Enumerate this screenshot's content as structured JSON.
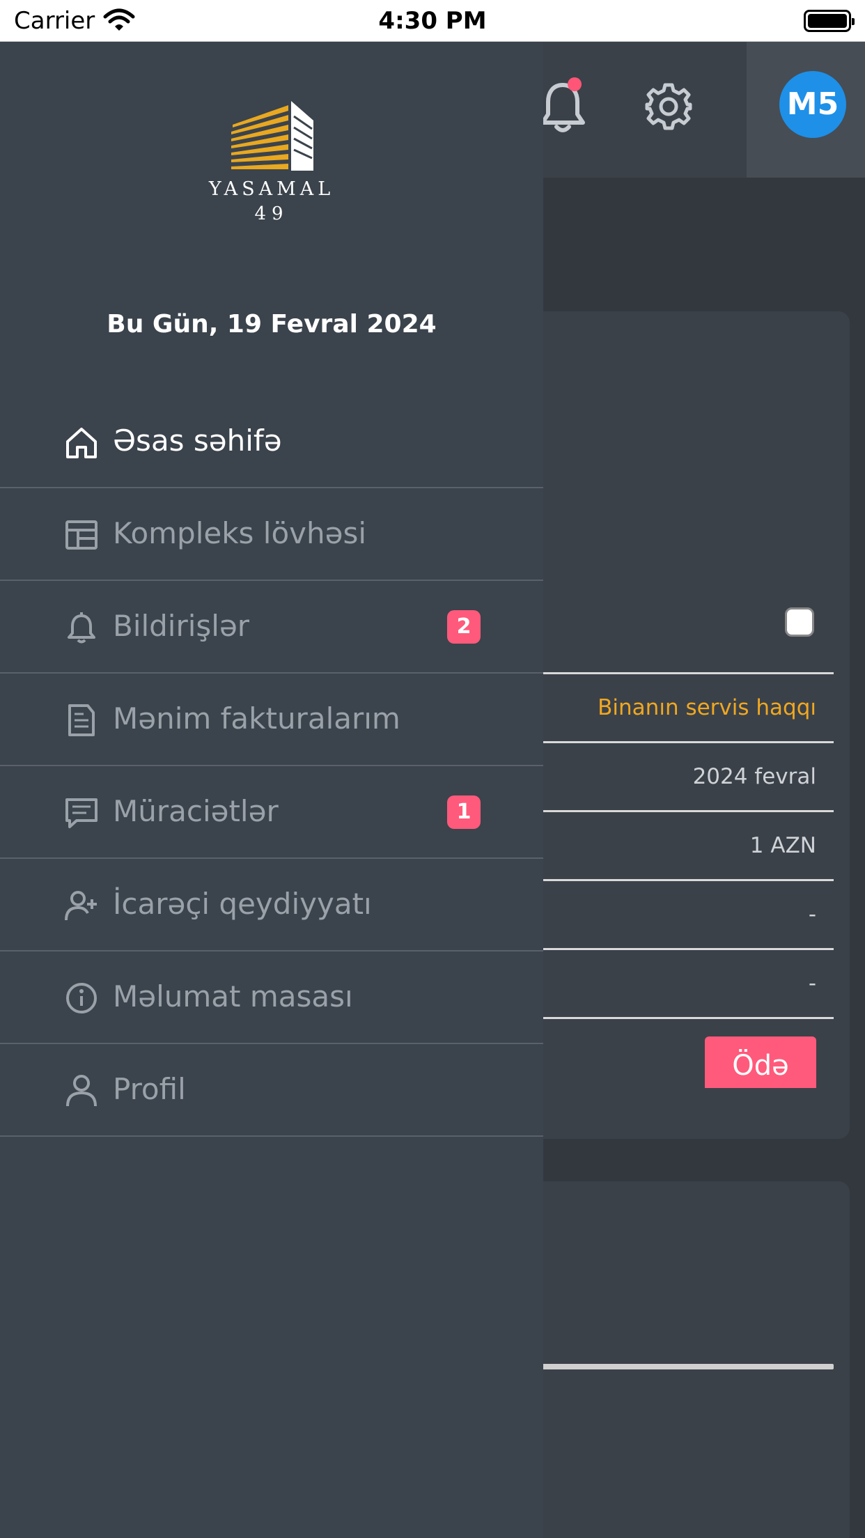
{
  "status_bar": {
    "carrier": "Carrier",
    "time": "4:30 PM"
  },
  "header": {
    "avatar_initials": "M5",
    "notification_dot_color": "#ff5576",
    "avatar_color": "#1e90e8"
  },
  "card": {
    "rows": [
      "Binanın servis haqqı",
      "2024 fevral",
      "1 AZN",
      "-",
      "-"
    ],
    "pay_label": "Ödə",
    "accent_color": "#f0a820"
  },
  "drawer": {
    "logo_name": "YASAMAL",
    "logo_number": "49",
    "today": "Bu Gün, 19 Fevral 2024",
    "items": [
      {
        "label": "Əsas səhifə",
        "icon": "home-icon",
        "active": true
      },
      {
        "label": "Kompleks lövhəsi",
        "icon": "board-icon"
      },
      {
        "label": "Bildirişlər",
        "icon": "bell-icon",
        "badge": "2"
      },
      {
        "label": "Mənim fakturalarım",
        "icon": "invoice-icon"
      },
      {
        "label": "Müraciətlər",
        "icon": "message-icon",
        "badge": "1"
      },
      {
        "label": "İcarəçi qeydiyyatı",
        "icon": "add-user-icon"
      },
      {
        "label": "Məlumat masası",
        "icon": "info-icon"
      },
      {
        "label": "Profil",
        "icon": "user-icon"
      }
    ],
    "badge_color": "#ff5a7b"
  }
}
